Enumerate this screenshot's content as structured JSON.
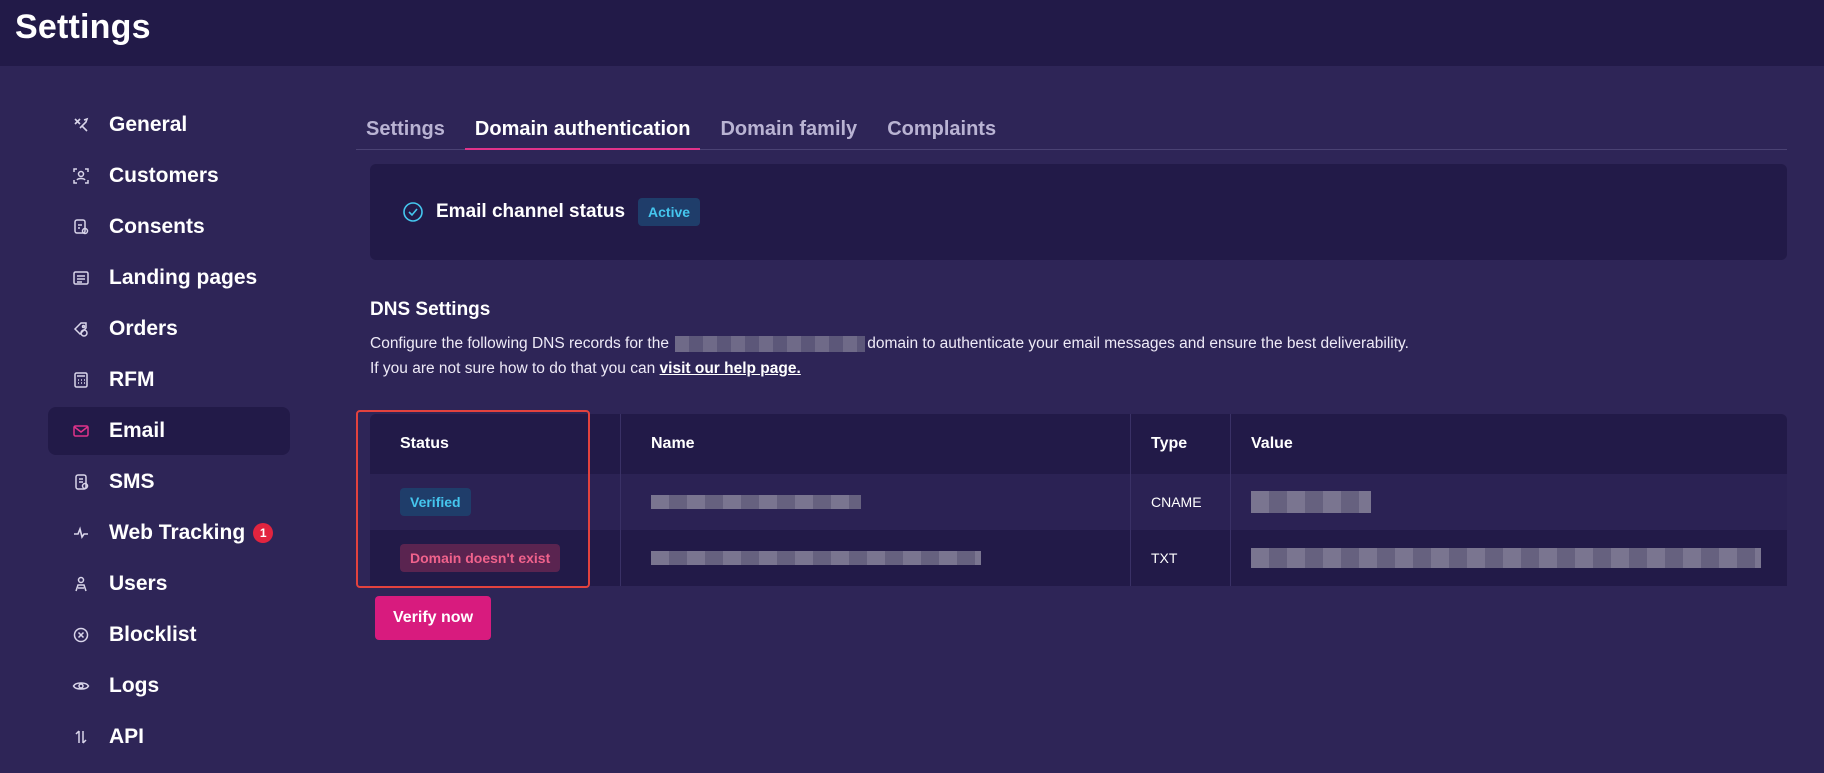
{
  "header": {
    "title": "Settings"
  },
  "sidebar": {
    "items": [
      {
        "label": "General",
        "icon": "tools-icon"
      },
      {
        "label": "Customers",
        "icon": "customer-icon"
      },
      {
        "label": "Consents",
        "icon": "consent-icon"
      },
      {
        "label": "Landing pages",
        "icon": "landing-page-icon"
      },
      {
        "label": "Orders",
        "icon": "orders-icon"
      },
      {
        "label": "RFM",
        "icon": "calculator-icon"
      },
      {
        "label": "Email",
        "icon": "mail-icon",
        "active": true
      },
      {
        "label": "SMS",
        "icon": "sms-icon"
      },
      {
        "label": "Web Tracking",
        "icon": "pulse-icon",
        "badge": "1"
      },
      {
        "label": "Users",
        "icon": "users-icon"
      },
      {
        "label": "Blocklist",
        "icon": "block-icon"
      },
      {
        "label": "Logs",
        "icon": "eye-icon"
      },
      {
        "label": "API",
        "icon": "api-icon"
      }
    ]
  },
  "tabs": [
    {
      "label": "Settings"
    },
    {
      "label": "Domain authentication",
      "active": true
    },
    {
      "label": "Domain family"
    },
    {
      "label": "Complaints"
    }
  ],
  "status_card": {
    "label": "Email channel status",
    "badge": "Active"
  },
  "dns": {
    "title": "DNS Settings",
    "desc_before": "Configure the following DNS records for the",
    "desc_after": "domain to authenticate your email messages and ensure the best deliverability.",
    "help_before": "If you are not sure how to do that you can",
    "help_link": "visit our help page."
  },
  "table": {
    "headers": {
      "status": "Status",
      "name": "Name",
      "type": "Type",
      "value": "Value"
    },
    "rows": [
      {
        "status": "Verified",
        "type": "CNAME"
      },
      {
        "status": "Domain doesn't exist",
        "type": "TXT"
      }
    ]
  },
  "verify_button": "Verify now",
  "colors": {
    "background": "#2e2557",
    "panel": "#221a48",
    "accent": "#d81b7e",
    "success": "#45c6ee",
    "error": "#f0628c"
  }
}
